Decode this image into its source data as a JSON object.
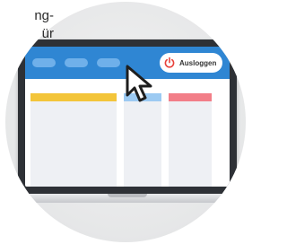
{
  "intro_text": {
    "line1": "ng-",
    "line2": "ür"
  },
  "header": {
    "logout_label": "Ausloggen",
    "logout_icon": "power-icon",
    "nav_items": [
      "nav-pill",
      "nav-pill",
      "nav-pill"
    ]
  },
  "columns": [
    {
      "accent": "#f3c53a"
    },
    {
      "accent": "#9ccaf2"
    },
    {
      "accent": "#f27e88"
    }
  ],
  "colors": {
    "navbar": "#2f86d3",
    "logout_icon": "#e8413a",
    "cursor_fill": "#ffffff",
    "cursor_outline": "#1e1e1e"
  }
}
